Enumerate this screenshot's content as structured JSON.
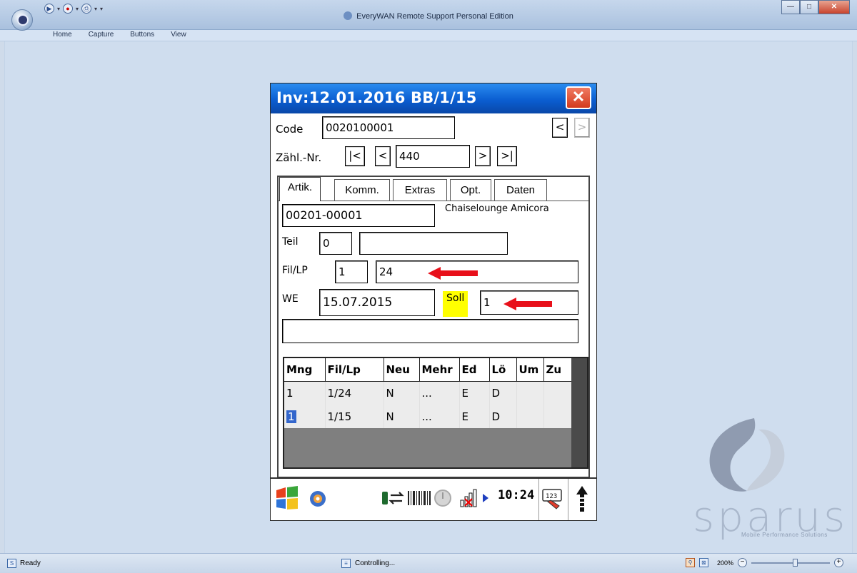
{
  "window": {
    "title": "EveryWAN Remote Support Personal Edition",
    "menu": [
      "Home",
      "Capture",
      "Buttons",
      "View"
    ]
  },
  "status": {
    "ready": "Ready",
    "controlling": "Controlling...",
    "zoom": "200%"
  },
  "pda": {
    "title": "Inv:12.01.2016 BB/1/15",
    "code_label": "Code",
    "code_value": "0020100001",
    "prev_label": "<",
    "next_label": ">",
    "zaehl_label": "Zähl.-Nr.",
    "first_btn": "|<",
    "prev_btn": "<",
    "zaehl_value": "440",
    "next_btn": ">",
    "last_btn": ">|",
    "tabs": [
      "Artik.",
      "Komm.",
      "Extras",
      "Opt.",
      "Daten"
    ],
    "article_no": "00201-00001",
    "article_name": "Chaiselounge Amicora",
    "teil_label": "Teil",
    "teil_value": "0",
    "teil_desc": "",
    "fillp_label": "Fil/LP",
    "fil_value": "1",
    "lp_value": "24",
    "we_label": "WE",
    "we_date": "15.07.2015",
    "soll_label": "Soll",
    "soll_value": "1",
    "extra_field": "",
    "grid": {
      "headers": [
        "Mng",
        "Fil/Lp",
        "Neu",
        "Mehr",
        "Ed",
        "Lö",
        "Um",
        "Zu"
      ],
      "rows": [
        [
          "1",
          "1/24",
          "N",
          "...",
          "E",
          "D",
          "",
          ""
        ],
        [
          "1",
          "1/15",
          "N",
          "...",
          "E",
          "D",
          "",
          ""
        ]
      ]
    },
    "clock": "10:24"
  },
  "branding": {
    "word": "sparus",
    "tagline": "Mobile Performance Solutions"
  },
  "colors": {
    "highlight": "#ffff00",
    "arrow": "#e8101a",
    "pda_title": "#0b5ed1"
  }
}
